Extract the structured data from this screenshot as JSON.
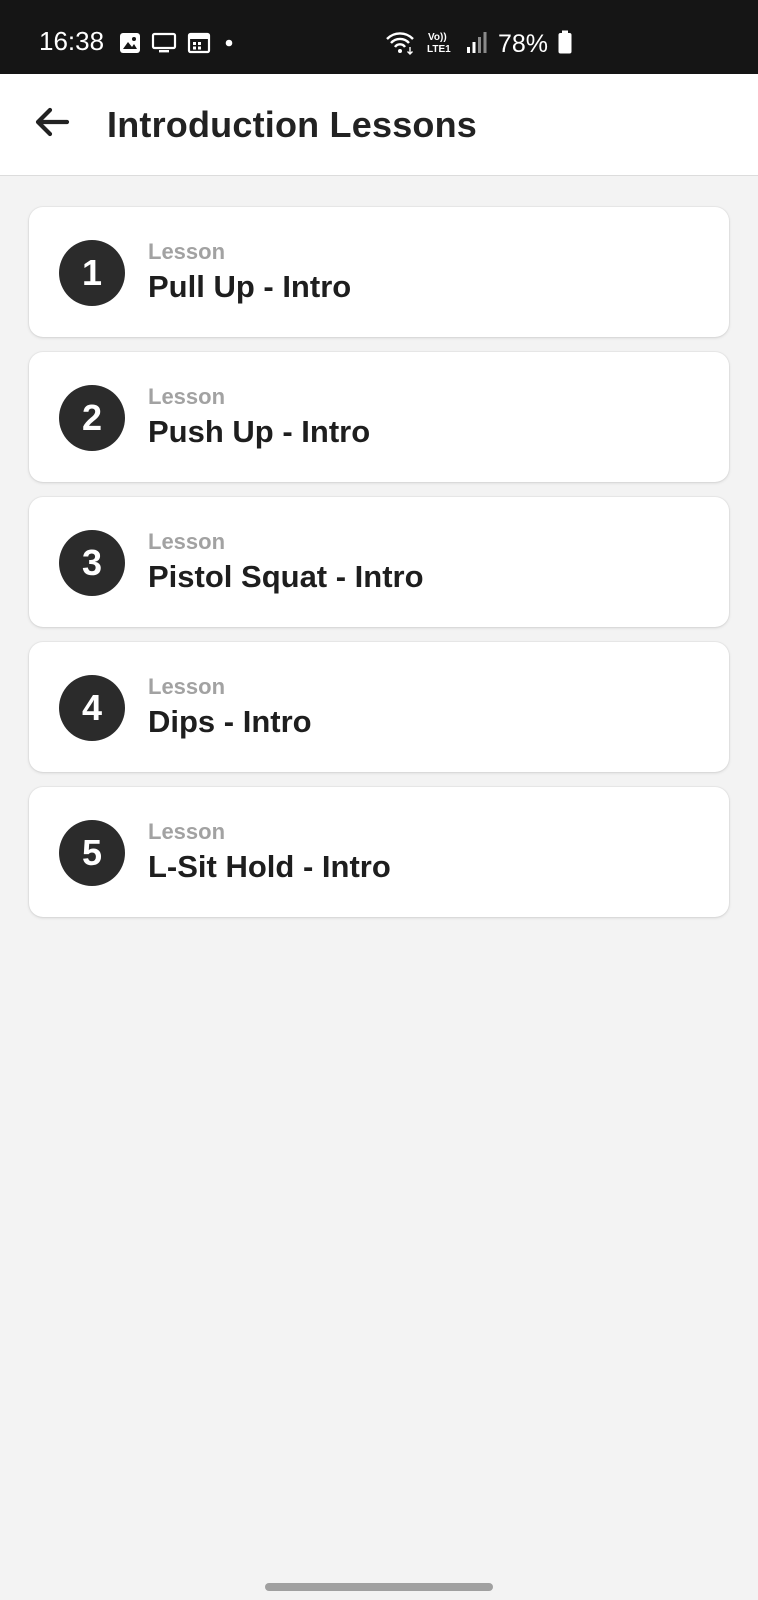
{
  "status_bar": {
    "time": "16:38",
    "battery": "78%",
    "left_icons": [
      "gallery-icon",
      "screen-cast-icon",
      "calendar-icon",
      "dot-icon"
    ],
    "right_icons": [
      "wifi-icon",
      "volte-icon",
      "signal-icon",
      "battery-icon"
    ]
  },
  "header": {
    "back_icon": "arrow-left-icon",
    "title": "Introduction Lessons"
  },
  "lessons": [
    {
      "number": "1",
      "kicker": "Lesson",
      "title": "Pull Up - Intro"
    },
    {
      "number": "2",
      "kicker": "Lesson",
      "title": "Push Up - Intro"
    },
    {
      "number": "3",
      "kicker": "Lesson",
      "title": "Pistol Squat - Intro"
    },
    {
      "number": "4",
      "kicker": "Lesson",
      "title": "Dips - Intro"
    },
    {
      "number": "5",
      "kicker": "Lesson",
      "title": "L-Sit Hold - Intro"
    }
  ],
  "colors": {
    "status_bar_bg": "#151515",
    "page_bg": "#f3f3f3",
    "card_bg": "#ffffff",
    "badge_bg": "#2b2b2b",
    "kicker_text": "#a2a2a2",
    "title_text": "#1e1e1e"
  }
}
